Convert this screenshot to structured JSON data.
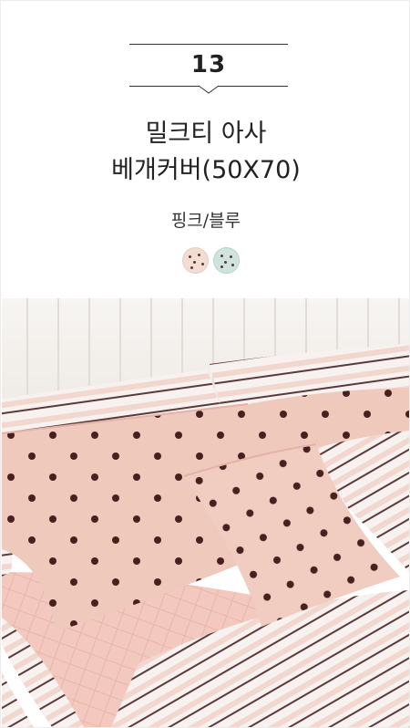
{
  "item": {
    "number": "13",
    "title_line1": "밀크티 아사",
    "title_line2": "베개커버(50X70)",
    "color_options_text": "핑크/블루"
  },
  "swatches": [
    {
      "name": "pink",
      "color": "#f3ddd2"
    },
    {
      "name": "blue",
      "color": "#cfe3df"
    }
  ],
  "photo": {
    "pillow_color": "#f0c9bd",
    "dot_color": "#4a1f1f",
    "stripe_color": "#5a3a3a",
    "wall_color": "#f4f1ee"
  }
}
